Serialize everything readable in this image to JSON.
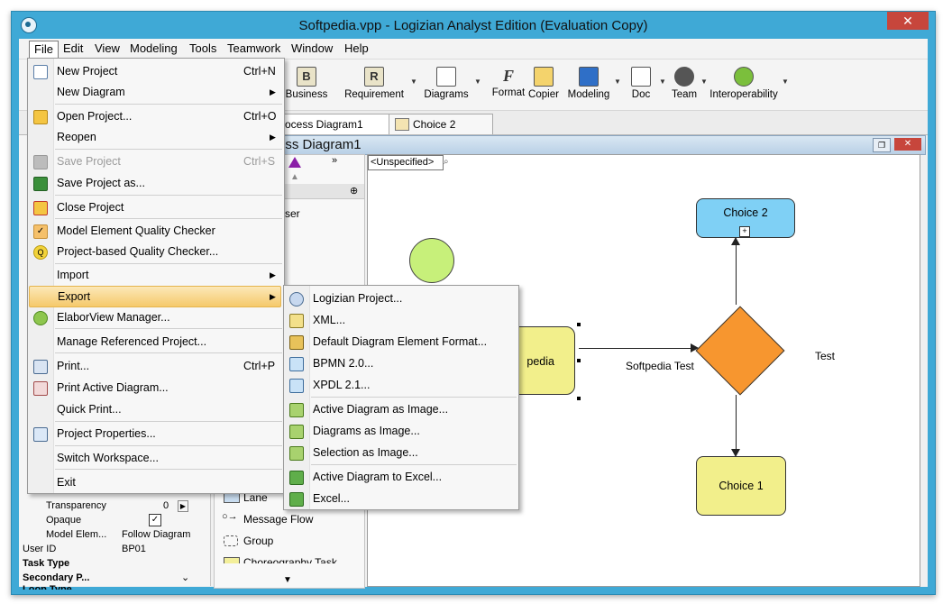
{
  "window": {
    "title": "Softpedia.vpp - Logizian Analyst Edition (Evaluation Copy)",
    "close_label": "✕"
  },
  "menubar": [
    "File",
    "Edit",
    "View",
    "Modeling",
    "Tools",
    "Teamwork",
    "Window",
    "Help"
  ],
  "toolbar": {
    "buttons": [
      {
        "label": "Business",
        "icon": "business-icon"
      },
      {
        "label": "Requirement",
        "icon": "requirement-icon"
      },
      {
        "label": "Diagrams",
        "icon": "diagrams-icon"
      },
      {
        "label": "Format",
        "icon": "format-icon"
      },
      {
        "label": "Copier",
        "icon": "copier-icon"
      },
      {
        "label": "Modeling",
        "icon": "modeling-icon"
      },
      {
        "label": "Doc",
        "icon": "doc-icon"
      },
      {
        "label": "Team",
        "icon": "team-icon"
      },
      {
        "label": "Interoperability",
        "icon": "interoperability-icon"
      }
    ]
  },
  "tabs": [
    {
      "label": "ocess Diagram1"
    },
    {
      "label": "Choice 2"
    }
  ],
  "panel": {
    "title": "ss Process Diagram1"
  },
  "canvas": {
    "combo_value": "<Unspecified>",
    "nodes": {
      "choice2": "Choice 2",
      "choice1": "Choice 1",
      "task_partial": "pedia",
      "flow_label": "Softpedia Test",
      "test_label": "Test"
    }
  },
  "palette": {
    "items": [
      {
        "label": "ser"
      },
      {
        "label": "Lane"
      },
      {
        "label": "Message Flow"
      },
      {
        "label": "Group"
      },
      {
        "label": "Choreography Task"
      }
    ]
  },
  "properties": {
    "rows": [
      {
        "name": "Transparency",
        "value": "0"
      },
      {
        "name": "Opaque",
        "value": ""
      },
      {
        "name": "Model Elem...",
        "value": "Follow Diagram"
      },
      {
        "name": "User ID",
        "value": "BP01"
      },
      {
        "name": "Task Type",
        "value": ""
      },
      {
        "name": "Secondary P...",
        "value": ""
      },
      {
        "name": "Loop Type",
        "value": ""
      }
    ]
  },
  "file_menu": {
    "items": [
      {
        "label": "New Project",
        "shortcut": "Ctrl+N",
        "icon": "new-project-icon"
      },
      {
        "label": "New Diagram",
        "shortcut": "",
        "icon": "",
        "submenu": true
      },
      {
        "label": "Open Project...",
        "shortcut": "Ctrl+O",
        "icon": "open-folder-icon"
      },
      {
        "label": "Reopen",
        "shortcut": "",
        "icon": "",
        "submenu": true
      },
      {
        "label": "Save Project",
        "shortcut": "Ctrl+S",
        "icon": "save-icon",
        "disabled": true
      },
      {
        "label": "Save Project as...",
        "shortcut": "",
        "icon": "save-as-icon"
      },
      {
        "label": "Close Project",
        "shortcut": "",
        "icon": "close-project-icon"
      },
      {
        "label": "Model Element Quality Checker",
        "shortcut": "",
        "icon": "checkmark-icon"
      },
      {
        "label": "Project-based Quality Checker...",
        "shortcut": "",
        "icon": "quality-checker-icon"
      },
      {
        "label": "Import",
        "shortcut": "",
        "icon": "",
        "submenu": true
      },
      {
        "label": "Export",
        "shortcut": "",
        "icon": "",
        "submenu": true,
        "highlighted": true
      },
      {
        "label": "ElaborView Manager...",
        "shortcut": "",
        "icon": "elaborview-icon"
      },
      {
        "label": "Manage Referenced Project...",
        "shortcut": "",
        "icon": ""
      },
      {
        "label": "Print...",
        "shortcut": "Ctrl+P",
        "icon": "print-icon"
      },
      {
        "label": "Print Active Diagram...",
        "shortcut": "",
        "icon": "print-diagram-icon"
      },
      {
        "label": "Quick Print...",
        "shortcut": "",
        "icon": ""
      },
      {
        "label": "Project Properties...",
        "shortcut": "",
        "icon": "properties-icon"
      },
      {
        "label": "Switch Workspace...",
        "shortcut": "",
        "icon": ""
      },
      {
        "label": "Exit",
        "shortcut": "",
        "icon": ""
      }
    ]
  },
  "export_menu": {
    "items": [
      {
        "label": "Logizian Project...",
        "icon": "logizian-project-icon"
      },
      {
        "label": "XML...",
        "icon": "xml-icon"
      },
      {
        "label": "Default Diagram Element Format...",
        "icon": "format-brush-icon"
      },
      {
        "label": "BPMN 2.0...",
        "icon": "bpmn-icon"
      },
      {
        "label": "XPDL 2.1...",
        "icon": "xpdl-icon"
      },
      {
        "label": "Active Diagram as Image...",
        "icon": "image-icon"
      },
      {
        "label": "Diagrams as Image...",
        "icon": "images-icon"
      },
      {
        "label": "Selection as Image...",
        "icon": "selection-image-icon"
      },
      {
        "label": "Active Diagram to Excel...",
        "icon": "excel-icon"
      },
      {
        "label": "Excel...",
        "icon": "excel-file-icon"
      }
    ]
  }
}
